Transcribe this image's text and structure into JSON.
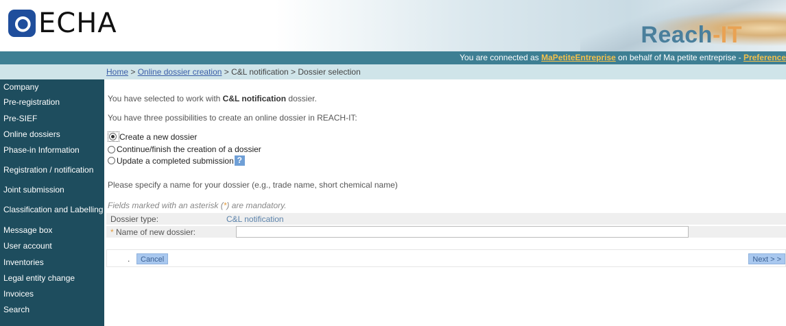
{
  "header": {
    "logo_text": "ECHA",
    "app_name_main": "Reach",
    "app_name_dash": "-",
    "app_name_suffix": "IT"
  },
  "connbar": {
    "prefix": "You are connected as ",
    "user": "MaPetiteEntreprise",
    "middle": " on behalf of Ma petite entreprise - ",
    "preferences": "Preference"
  },
  "breadcrumb": {
    "home": "Home",
    "sep1": " > ",
    "online_dossier_creation": "Online dossier creation",
    "rest": " > C&L notification > Dossier selection"
  },
  "sidebar": {
    "items": [
      {
        "label": "Company"
      },
      {
        "label": "Pre-registration"
      },
      {
        "label": "Pre-SIEF"
      },
      {
        "label": "Online dossiers"
      },
      {
        "label": "Phase-in Information"
      },
      {
        "label": "Registration / notification"
      },
      {
        "label": "Joint submission"
      },
      {
        "label": "Classification and Labelling"
      },
      {
        "label": "Message box"
      },
      {
        "label": "User account"
      },
      {
        "label": "Inventories"
      },
      {
        "label": "Legal entity change"
      },
      {
        "label": "Invoices"
      },
      {
        "label": "Search"
      }
    ]
  },
  "main": {
    "selected_prefix": "You have selected to work with ",
    "selected_bold": "C&L notification",
    "selected_suffix": " dossier.",
    "possibilities": "You have three possibilities to create an online dossier in REACH-IT:",
    "options": [
      {
        "label": "Create a new dossier",
        "checked": true
      },
      {
        "label": "Continue/finish the creation of a dossier",
        "checked": false
      },
      {
        "label": "Update a completed submission",
        "checked": false
      }
    ],
    "help_label": "?",
    "specify_name": "Please specify a name for your dossier (e.g., trade name, short chemical name)",
    "mandatory_prefix": "Fields marked with an asterisk (",
    "mandatory_asterisk": "*",
    "mandatory_suffix": ") are mandatory.",
    "dossier_type_label": "Dossier type:",
    "dossier_type_value": "C&L notification",
    "name_label_asterisk": "*",
    "name_label": " Name of new dossier:",
    "name_value": "",
    "dot": ".",
    "cancel_button": "Cancel",
    "next_button": "Next > >"
  },
  "colors": {
    "sidebar_bg": "#1e4d5e",
    "connbar_bg": "#3e7f93",
    "breadcrumb_bg": "#cfe4e9",
    "accent_orange": "#f3c14d",
    "button_bg": "#a9c8ef"
  }
}
